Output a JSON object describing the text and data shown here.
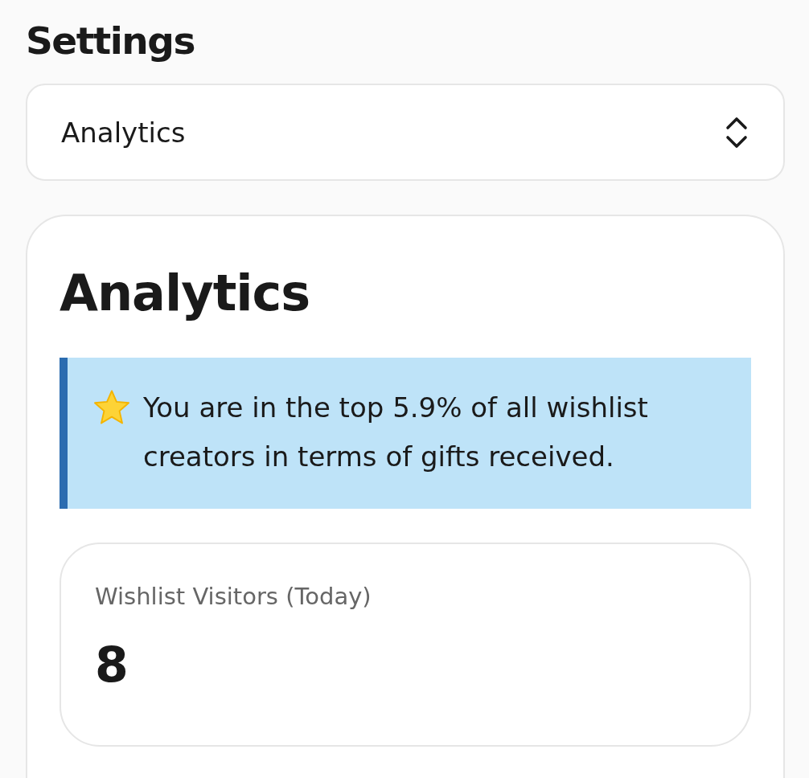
{
  "page": {
    "title": "Settings"
  },
  "section_select": {
    "value": "Analytics"
  },
  "analytics_card": {
    "title": "Analytics",
    "callout": {
      "text": "You are in the top 5.9% of all wishlist creators in terms of gifts received."
    },
    "stats": [
      {
        "label": "Wishlist Visitors (Today)",
        "value": "8"
      }
    ]
  }
}
